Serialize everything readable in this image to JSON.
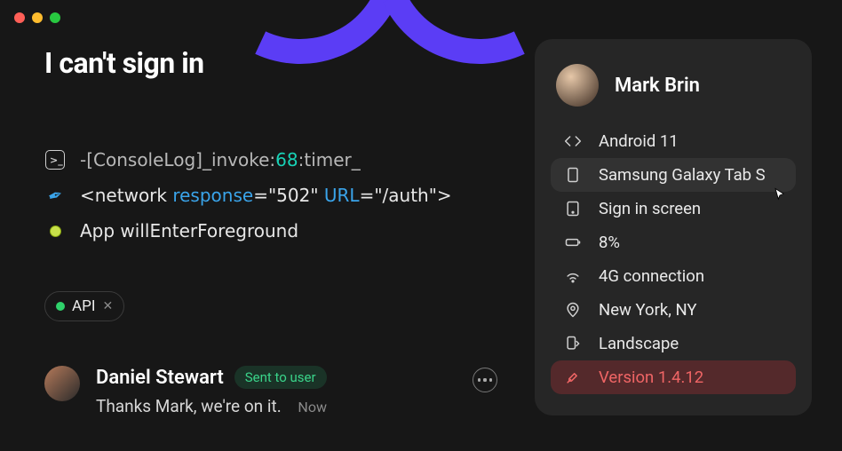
{
  "title": "I can't sign in",
  "logs": {
    "l1_prefix": "-[ConsoleLog]_invoke:",
    "l1_num": "68",
    "l1_suffix": ":timer_",
    "l2_open": "<network ",
    "l2_attr1": "response",
    "l2_eq1": "=\"502\" ",
    "l2_attr2": "URL",
    "l2_eq2": "=\"/auth\">",
    "l3": "App willEnterForeground"
  },
  "tag": {
    "label": "API"
  },
  "comment": {
    "author": "Daniel Stewart",
    "status": "Sent to user",
    "body": "Thanks Mark, we're on it.",
    "time": "Now"
  },
  "panel": {
    "name": "Mark Brin",
    "rows": {
      "os": "Android 11",
      "device": "Samsung Galaxy Tab S",
      "screen": "Sign in screen",
      "battery": "8%",
      "network": "4G connection",
      "location": "New York, NY",
      "orientation": "Landscape",
      "version": "Version 1.4.12"
    }
  }
}
